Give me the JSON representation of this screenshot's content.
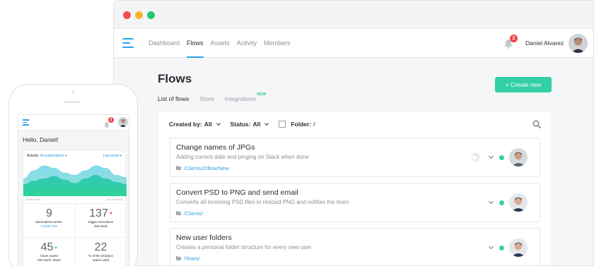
{
  "colors": {
    "accent": "#2fa0e5",
    "primary_button": "#33d0a6",
    "status_active": "#33d0a6",
    "badge": "#f2454d"
  },
  "window": {
    "nav": [
      {
        "label": "Dashboard",
        "active": false
      },
      {
        "label": "Flows",
        "active": true
      },
      {
        "label": "Assets",
        "active": false
      },
      {
        "label": "Activity",
        "active": false
      },
      {
        "label": "Members",
        "active": false
      }
    ],
    "notifications_count": "2",
    "user_name": "Daniel Alvarez",
    "page_title": "Flows",
    "create_button_label": "+ Create new",
    "subtabs": [
      {
        "label": "List of flows",
        "active": true
      },
      {
        "label": "Store",
        "active": false
      },
      {
        "label": "Integrations",
        "active": false,
        "badge": "NEW"
      }
    ],
    "filters": {
      "created_by_label": "Created by:",
      "created_by_value": "All",
      "status_label": "Status:",
      "status_value": "All",
      "folder_label": "Folder:",
      "folder_value": "/"
    },
    "flows": [
      {
        "title": "Change names of JPGs",
        "description": "Adding current date and pinging on Slack when done",
        "path": "/Clients/Ziflow/New",
        "loading": true,
        "status": "active"
      },
      {
        "title": "Convert PSD to PNG and send email",
        "description": "Converts all incoming PSD files to resized PNG and notifies the team",
        "path": "/Clients/",
        "loading": false,
        "status": "active"
      },
      {
        "title": "New user folders",
        "description": "Creates a personal folder structure for every new user",
        "path": "/Team/",
        "loading": false,
        "status": "active"
      }
    ],
    "icons": [
      "logo-icon",
      "bell-icon",
      "search-icon",
      "folder-icon",
      "chevron-down-icon",
      "spinner-icon"
    ]
  },
  "mobile": {
    "notifications_count": "2",
    "greeting": "Hello, Daniel!",
    "activity_label": "Activity:",
    "activity_value": "All automations",
    "period": "Last week",
    "date_start": "9 Feb 2016",
    "date_end": "16 Feb 2016",
    "chart_data": {
      "type": "area",
      "series": [
        {
          "values": [
            30,
            44,
            52,
            48,
            40,
            36,
            44,
            52,
            48,
            36,
            32
          ]
        },
        {
          "values": [
            20,
            26,
            30,
            34,
            28,
            22,
            30,
            36,
            30,
            24,
            20
          ]
        }
      ]
    },
    "stats": [
      {
        "value": "9",
        "label": "automations active.",
        "link": "Create new",
        "trend": ""
      },
      {
        "value": "137",
        "label": "trigger executions",
        "label2": "last week",
        "trend": "down"
      },
      {
        "value": "45",
        "label": "hours saved",
        "label2": "last week. Wow!",
        "trend": "up"
      },
      {
        "value": "22",
        "label": "% of the Dropbox",
        "label2": "space used",
        "trend": ""
      }
    ]
  }
}
